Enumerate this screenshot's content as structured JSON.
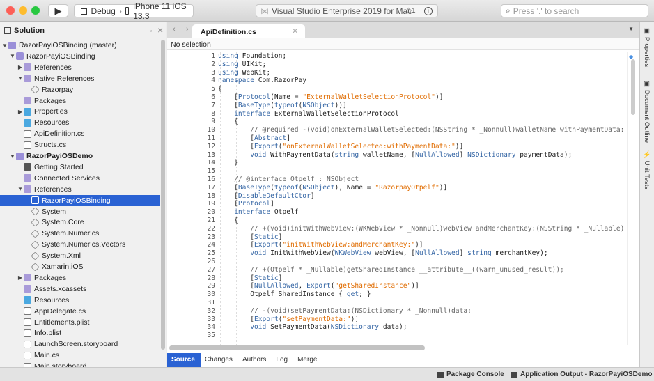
{
  "toolbar": {
    "config": "Debug",
    "separator": "›",
    "device": "iPhone 11 iOS 13.3",
    "app_title": "Visual Studio Enterprise 2019 for Mac",
    "warning_count": "1",
    "search_placeholder": "Press '.' to search"
  },
  "sidebar": {
    "title": "Solution",
    "items": [
      {
        "label": "RazorPayiOSBinding (master)",
        "level": 0,
        "state": "open",
        "icon": "solution",
        "color": "#9a8fd8"
      },
      {
        "label": "RazorPayiOSBinding",
        "level": 1,
        "state": "open",
        "icon": "project",
        "color": "#9a8fd8"
      },
      {
        "label": "References",
        "level": 2,
        "state": "closed",
        "icon": "folder",
        "color": "#a99bd9"
      },
      {
        "label": "Native References",
        "level": 2,
        "state": "open",
        "icon": "folder",
        "color": "#a99bd9"
      },
      {
        "label": "Razorpay",
        "level": 3,
        "state": "",
        "icon": "package",
        "color": "#888"
      },
      {
        "label": "Packages",
        "level": 2,
        "state": "",
        "icon": "folder",
        "color": "#a99bd9"
      },
      {
        "label": "Properties",
        "level": 2,
        "state": "closed",
        "icon": "folder",
        "color": "#4aa8e0"
      },
      {
        "label": "Resources",
        "level": 2,
        "state": "",
        "icon": "folder",
        "color": "#4aa8e0"
      },
      {
        "label": "ApiDefinition.cs",
        "level": 2,
        "state": "",
        "icon": "file",
        "color": "#fff"
      },
      {
        "label": "Structs.cs",
        "level": 2,
        "state": "",
        "icon": "file",
        "color": "#fff"
      },
      {
        "label": "RazorPayiOSDemo",
        "level": 1,
        "state": "open",
        "icon": "project",
        "color": "#9a8fd8",
        "bold": true
      },
      {
        "label": "Getting Started",
        "level": 2,
        "state": "",
        "icon": "rocket",
        "color": "#555"
      },
      {
        "label": "Connected Services",
        "level": 2,
        "state": "",
        "icon": "folder",
        "color": "#a99bd9"
      },
      {
        "label": "References",
        "level": 2,
        "state": "open",
        "icon": "folder",
        "color": "#a99bd9"
      },
      {
        "label": "RazorPayiOSBinding",
        "level": 3,
        "state": "",
        "icon": "reference",
        "color": "#fff",
        "selected": true
      },
      {
        "label": "System",
        "level": 3,
        "state": "",
        "icon": "package",
        "color": "#888"
      },
      {
        "label": "System.Core",
        "level": 3,
        "state": "",
        "icon": "package",
        "color": "#888"
      },
      {
        "label": "System.Numerics",
        "level": 3,
        "state": "",
        "icon": "package",
        "color": "#888"
      },
      {
        "label": "System.Numerics.Vectors",
        "level": 3,
        "state": "",
        "icon": "package",
        "color": "#888"
      },
      {
        "label": "System.Xml",
        "level": 3,
        "state": "",
        "icon": "package",
        "color": "#888"
      },
      {
        "label": "Xamarin.iOS",
        "level": 3,
        "state": "",
        "icon": "package",
        "color": "#888"
      },
      {
        "label": "Packages",
        "level": 2,
        "state": "closed",
        "icon": "folder",
        "color": "#a99bd9"
      },
      {
        "label": "Assets.xcassets",
        "level": 2,
        "state": "",
        "icon": "folder",
        "color": "#a99bd9"
      },
      {
        "label": "Resources",
        "level": 2,
        "state": "",
        "icon": "folder",
        "color": "#4aa8e0"
      },
      {
        "label": "AppDelegate.cs",
        "level": 2,
        "state": "",
        "icon": "file",
        "color": "#fff"
      },
      {
        "label": "Entitlements.plist",
        "level": 2,
        "state": "",
        "icon": "file",
        "color": "#fff"
      },
      {
        "label": "Info.plist",
        "level": 2,
        "state": "",
        "icon": "file",
        "color": "#fff"
      },
      {
        "label": "LaunchScreen.storyboard",
        "level": 2,
        "state": "",
        "icon": "file",
        "color": "#fff"
      },
      {
        "label": "Main.cs",
        "level": 2,
        "state": "",
        "icon": "file",
        "color": "#fff"
      },
      {
        "label": "Main.storyboard",
        "level": 2,
        "state": "",
        "icon": "file",
        "color": "#fff"
      }
    ]
  },
  "editor": {
    "tab": "ApiDefinition.cs",
    "path_bar": "No selection",
    "lines": [
      "using Foundation;",
      "using UIKit;",
      "using WebKit;",
      "namespace Com.RazorPay",
      "{",
      "    [Protocol(Name = \"ExternalWalletSelectionProtocol\")]",
      "    [BaseType(typeof(NSObject))]",
      "    interface ExternalWalletSelectionProtocol",
      "    {",
      "        // @required -(void)onExternalWalletSelected:(NSString * _Nonnull)walletName withPaymentData:",
      "        [Abstract]",
      "        [Export(\"onExternalWalletSelected:withPaymentData:\")]",
      "        void WithPaymentData(string walletName, [NullAllowed] NSDictionary paymentData);",
      "    }",
      "",
      "    // @interface Otpelf : NSObject",
      "    [BaseType(typeof(NSObject), Name = \"RazorpayOtpelf\")]",
      "    [DisableDefaultCtor]",
      "    [Protocol]",
      "    interface Otpelf",
      "    {",
      "        // +(void)initWithWebView:(WKWebView * _Nonnull)webView andMerchantKey:(NSString * _Nullable)",
      "        [Static]",
      "        [Export(\"initWithWebView:andMerchantKey:\")]",
      "        void InitWithWebView(WKWebView webView, [NullAllowed] string merchantKey);",
      "",
      "        // +(Otpelf * _Nullable)getSharedInstance __attribute__((warn_unused_result));",
      "        [Static]",
      "        [NullAllowed, Export(\"getSharedInstance\")]",
      "        Otpelf SharedInstance { get; }",
      "",
      "        // -(void)setPaymentData:(NSDictionary * _Nonnull)data;",
      "        [Export(\"setPaymentData:\")]",
      "        void SetPaymentData(NSDictionary data);",
      ""
    ],
    "bottom_tabs": [
      "Source",
      "Changes",
      "Authors",
      "Log",
      "Merge"
    ]
  },
  "right_panel": [
    "Properties",
    "Document Outline",
    "Unit Tests"
  ],
  "status": {
    "package_console": "Package Console",
    "app_output": "Application Output - RazorPayiOSDemo"
  },
  "colors": {
    "accent": "#2a62d3"
  }
}
